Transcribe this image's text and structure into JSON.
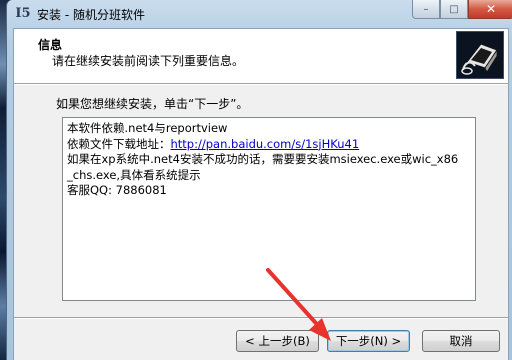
{
  "window": {
    "title": "安装 - 随机分班软件",
    "app_icon_glyph": "I5",
    "caption": {
      "minimize": "–",
      "maximize": "□",
      "close": "✕"
    }
  },
  "header": {
    "title": "信息",
    "subtitle": "请在继续安装前阅读下列重要信息。"
  },
  "intro": "如果您想继续安装，单击“下一步”。",
  "info_box": {
    "lines": [
      "本软件依赖.net4与reportview",
      "依赖文件下载地址：",
      "如果在xp系统中.net4安装不成功的话，需要要安装msiexec.exe或wic_x86",
      "_chs.exe,具体看系统提示",
      "客服QQ: 7886081"
    ],
    "link": "http://pan.baidu.com/s/1sjHKu41"
  },
  "buttons": {
    "back": "< 上一步(B)",
    "next": "下一步(N) >",
    "cancel": "取消"
  },
  "colors": {
    "annotation_arrow": "#e8322d",
    "link": "#0000cc"
  }
}
